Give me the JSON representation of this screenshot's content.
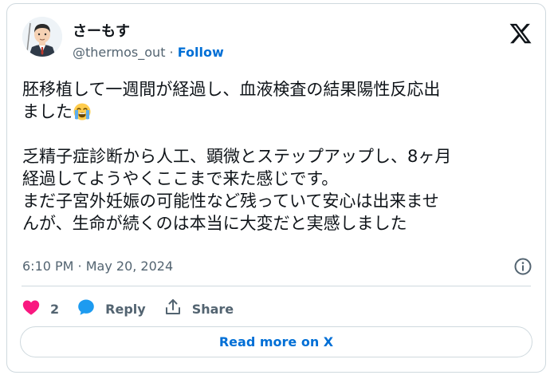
{
  "author": {
    "display_name": "さーもす",
    "handle": "@thermos_out",
    "separator": " · ",
    "follow_label": "Follow"
  },
  "tweet": {
    "line1": "胚移植して一週間が経過し、血液検査の結果陽性反応出",
    "line2": "ました",
    "emoji": "loudly-crying-face",
    "para2": "乏精子症診断から人工、顕微とステップアップし、8ヶ月\n経過してようやくここまで来た感じです。\nまだ子宮外妊娠の可能性など残っていて安心は出来ませ\nんが、生命が続くのは本当に大変だと実感しました",
    "timestamp": "6:10 PM · May 20, 2024"
  },
  "actions": {
    "like_count": "2",
    "reply_label": "Reply",
    "share_label": "Share"
  },
  "read_more_label": "Read more on X",
  "colors": {
    "text": "#0f1419",
    "secondary": "#536471",
    "link": "#006fd6",
    "heart": "#f91880",
    "reply": "#1d9bf0",
    "border": "#cfd9de"
  }
}
